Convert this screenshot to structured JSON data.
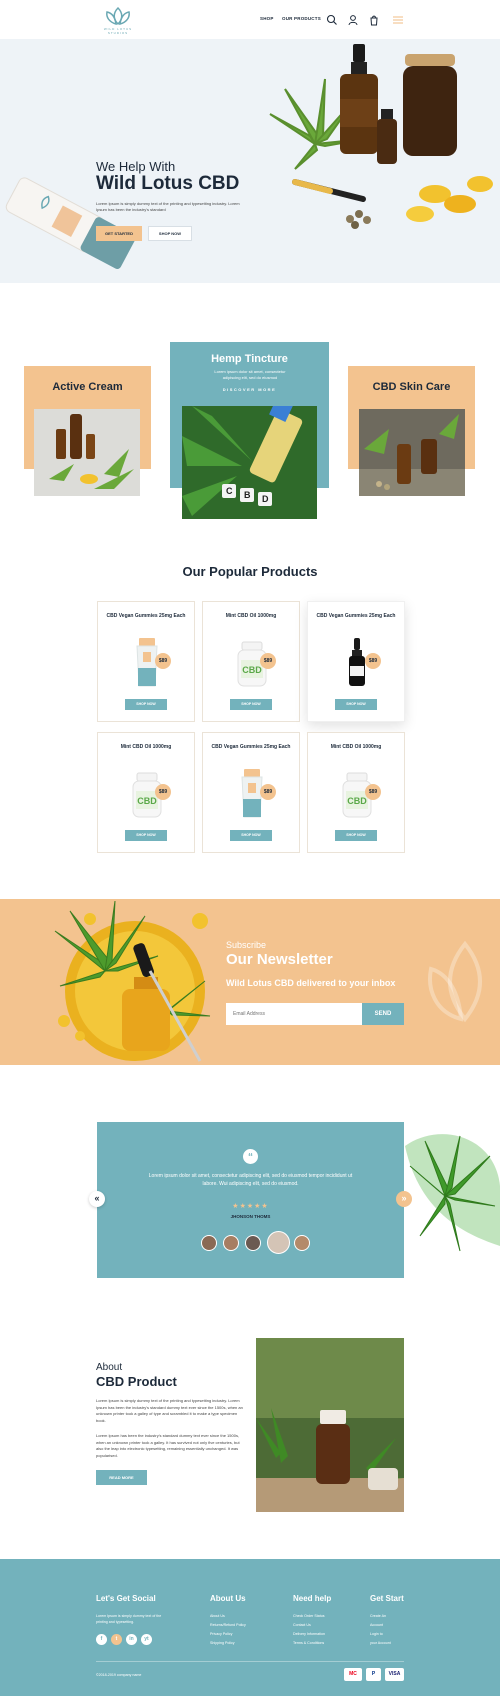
{
  "brand": {
    "logo_text": "WILD LOTUS STUDIOS"
  },
  "nav": {
    "items": [
      {
        "label": "SHOP"
      },
      {
        "label": "OUR PRODUCTS"
      }
    ]
  },
  "hero": {
    "kicker": "We Help With",
    "title": "Wild Lotus CBD",
    "body": "Lorem Ipsum is simply dummy text of the printing and typesetting industry. Lorem Ipsum has been the industry's standard",
    "primary_button": "GET STARTED",
    "secondary_button": "SHOP NOW"
  },
  "categories": [
    {
      "title": "Active Cream"
    },
    {
      "title": "Hemp Tincture",
      "body": "Lorem ipsum dolor sit amet, consectetur adipiscing elit, sed do eiusmod",
      "link": "DISCOVER MORE"
    },
    {
      "title": "CBD Skin Care"
    }
  ],
  "products_section": {
    "title": "Our Popular Products",
    "button_label": "SHOP NOW",
    "items": [
      {
        "name": "CBD Vegan Gummies 25mg Each",
        "price": "$89",
        "image": "tube"
      },
      {
        "name": "Mint CBD Oil 1000mg",
        "price": "$89",
        "image": "jar"
      },
      {
        "name": "CBD Vegan Gummies 25mg Each",
        "price": "$89",
        "image": "dropper"
      },
      {
        "name": "Mint CBD Oil 1000mg",
        "price": "$89",
        "image": "jar"
      },
      {
        "name": "CBD Vegan Gummies 25mg Each",
        "price": "$89",
        "image": "tube"
      },
      {
        "name": "Mint CBD Oil 1000mg",
        "price": "$89",
        "image": "jar"
      }
    ]
  },
  "newsletter": {
    "kicker": "Subscribe",
    "title": "Our Newsletter",
    "subtitle": "Wild Lotus CBD delivered to your inbox",
    "email_placeholder": "Email Address",
    "button": "SEND"
  },
  "testimonial": {
    "text": "Lorem ipsum dolor sit amet, consectetur adipiscing elit, sed do eiusmod tempor incididunt ut labore. Wui adipiscing elit, sed do eiusmod.",
    "rating": "★★★★★",
    "name": "JHONSON THOMS",
    "prev": "«",
    "next": "»"
  },
  "about": {
    "kicker": "About",
    "title": "CBD Product",
    "p1": "Lorem Ipsum is simply dummy text of the printing and typesetting industry. Lorem Ipsum has been the industry's standard dummy text ever since the 1500s, when an unknown printer took a galley of type and scrambled it to make a type specimen book.",
    "p2": "Lorem Ipsum has been the industry's standard dummy text ever since the 1500s, when an unknown printer took a galley. It has survived not only five centuries, but also the leap into electronic typesetting, remaining essentially unchanged. It was popularised.",
    "button": "READ MORE"
  },
  "footer": {
    "social_heading": "Let's Get Social",
    "social_text": "Lorem Ipsum is simply dummy text of the printing and typesetting.",
    "social_icons": [
      "f",
      "t",
      "in",
      "yt"
    ],
    "columns": [
      {
        "heading": "About Us",
        "links": [
          "About Us",
          "Returns/Refund Policy",
          "Privacy Policy",
          "Shipping Policy"
        ]
      },
      {
        "heading": "Need help",
        "links": [
          "Check Order Status",
          "Contact Us",
          "Delivery Information",
          "Terms & Conditions"
        ]
      },
      {
        "heading": "Get Start",
        "links": [
          "Create An",
          "Account",
          "Login to",
          "your Account"
        ]
      }
    ],
    "copyright": "©2018-2019 company name",
    "payments": [
      "MC",
      "P",
      "VISA"
    ]
  },
  "colors": {
    "teal": "#73b2bc",
    "peach": "#f3c38f",
    "navy": "#1d2a3a",
    "hero_bg": "#eef3f7"
  }
}
